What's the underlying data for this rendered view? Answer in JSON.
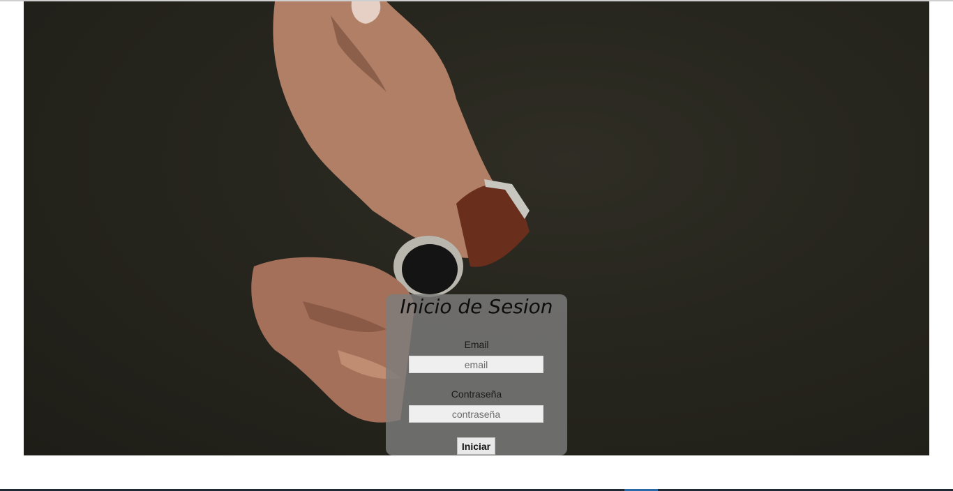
{
  "login": {
    "title": "Inicio de Sesion",
    "email_label": "Email",
    "email_placeholder": "email",
    "email_value": "",
    "password_label": "Contraseña",
    "password_placeholder": "contraseña",
    "password_value": "",
    "submit_label": "Iniciar"
  },
  "colors": {
    "hero_background": "#27261e",
    "panel_background": "#7d7d7d",
    "bottom_bar": "#1f2a35",
    "bottom_accent": "#2a6aa8"
  },
  "hero_image": {
    "subject": "hands-with-wristwatch-photo"
  }
}
